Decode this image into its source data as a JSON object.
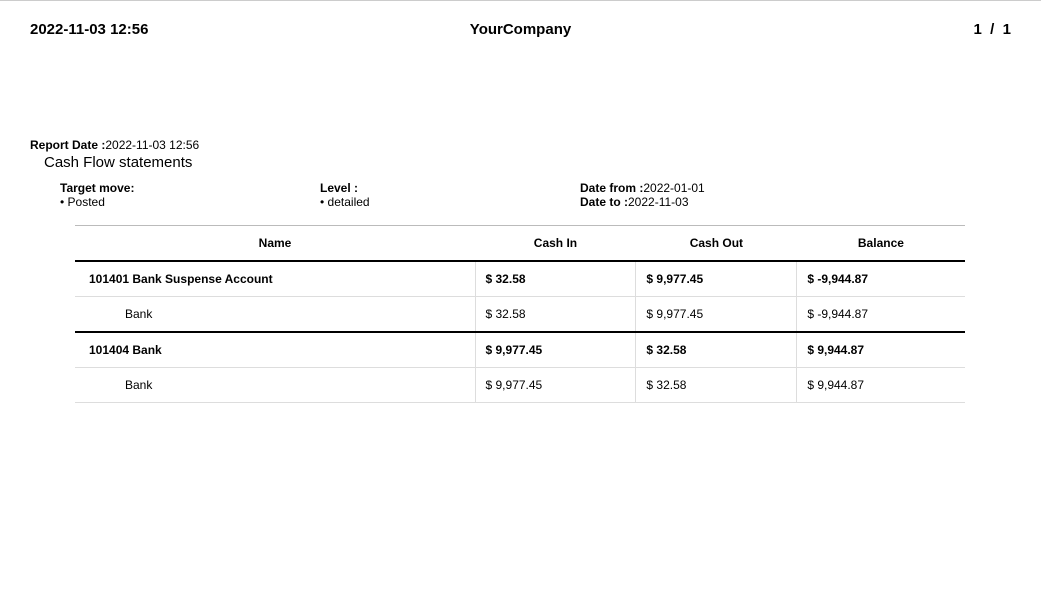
{
  "header": {
    "datetime": "2022-11-03 12:56",
    "company": "YourCompany",
    "page": "1  /  1"
  },
  "report": {
    "date_label": "Report Date :",
    "date_value": "2022-11-03 12:56",
    "title": "Cash Flow statements"
  },
  "filters": {
    "target_move_label": "Target move:",
    "target_move_value": "Posted",
    "level_label": "Level :",
    "level_value": "detailed",
    "date_from_label": "Date from :",
    "date_from_value": "2022-01-01",
    "date_to_label": "Date to :",
    "date_to_value": "2022-11-03"
  },
  "columns": {
    "name": "Name",
    "cash_in": "Cash In",
    "cash_out": "Cash Out",
    "balance": "Balance"
  },
  "rows": {
    "r0": {
      "name": "101401 Bank Suspense Account",
      "cash_in": "$ 32.58",
      "cash_out": "$ 9,977.45",
      "balance": "$ -9,944.87"
    },
    "r1": {
      "name": "Bank",
      "cash_in": "$ 32.58",
      "cash_out": "$ 9,977.45",
      "balance": "$ -9,944.87"
    },
    "r2": {
      "name": "101404 Bank",
      "cash_in": "$ 9,977.45",
      "cash_out": "$ 32.58",
      "balance": "$ 9,944.87"
    },
    "r3": {
      "name": "Bank",
      "cash_in": "$ 9,977.45",
      "cash_out": "$ 32.58",
      "balance": "$ 9,944.87"
    }
  }
}
